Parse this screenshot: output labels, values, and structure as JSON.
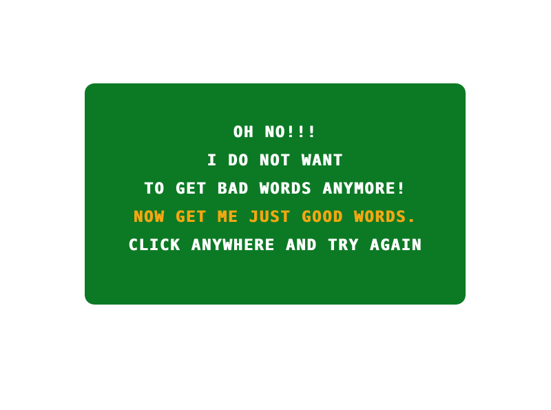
{
  "colors": {
    "background": "#ffffff",
    "panel": "#0c7a25",
    "text": "#ffffff",
    "highlight": "#f3a712"
  },
  "message": {
    "line1": "OH NO!!!",
    "line2": "I DO NOT WANT",
    "line3": "TO GET BAD WORDS ANYMORE!",
    "line4": "NOW GET ME JUST GOOD WORDS.",
    "line5": "CLICK ANYWHERE AND TRY AGAIN"
  }
}
